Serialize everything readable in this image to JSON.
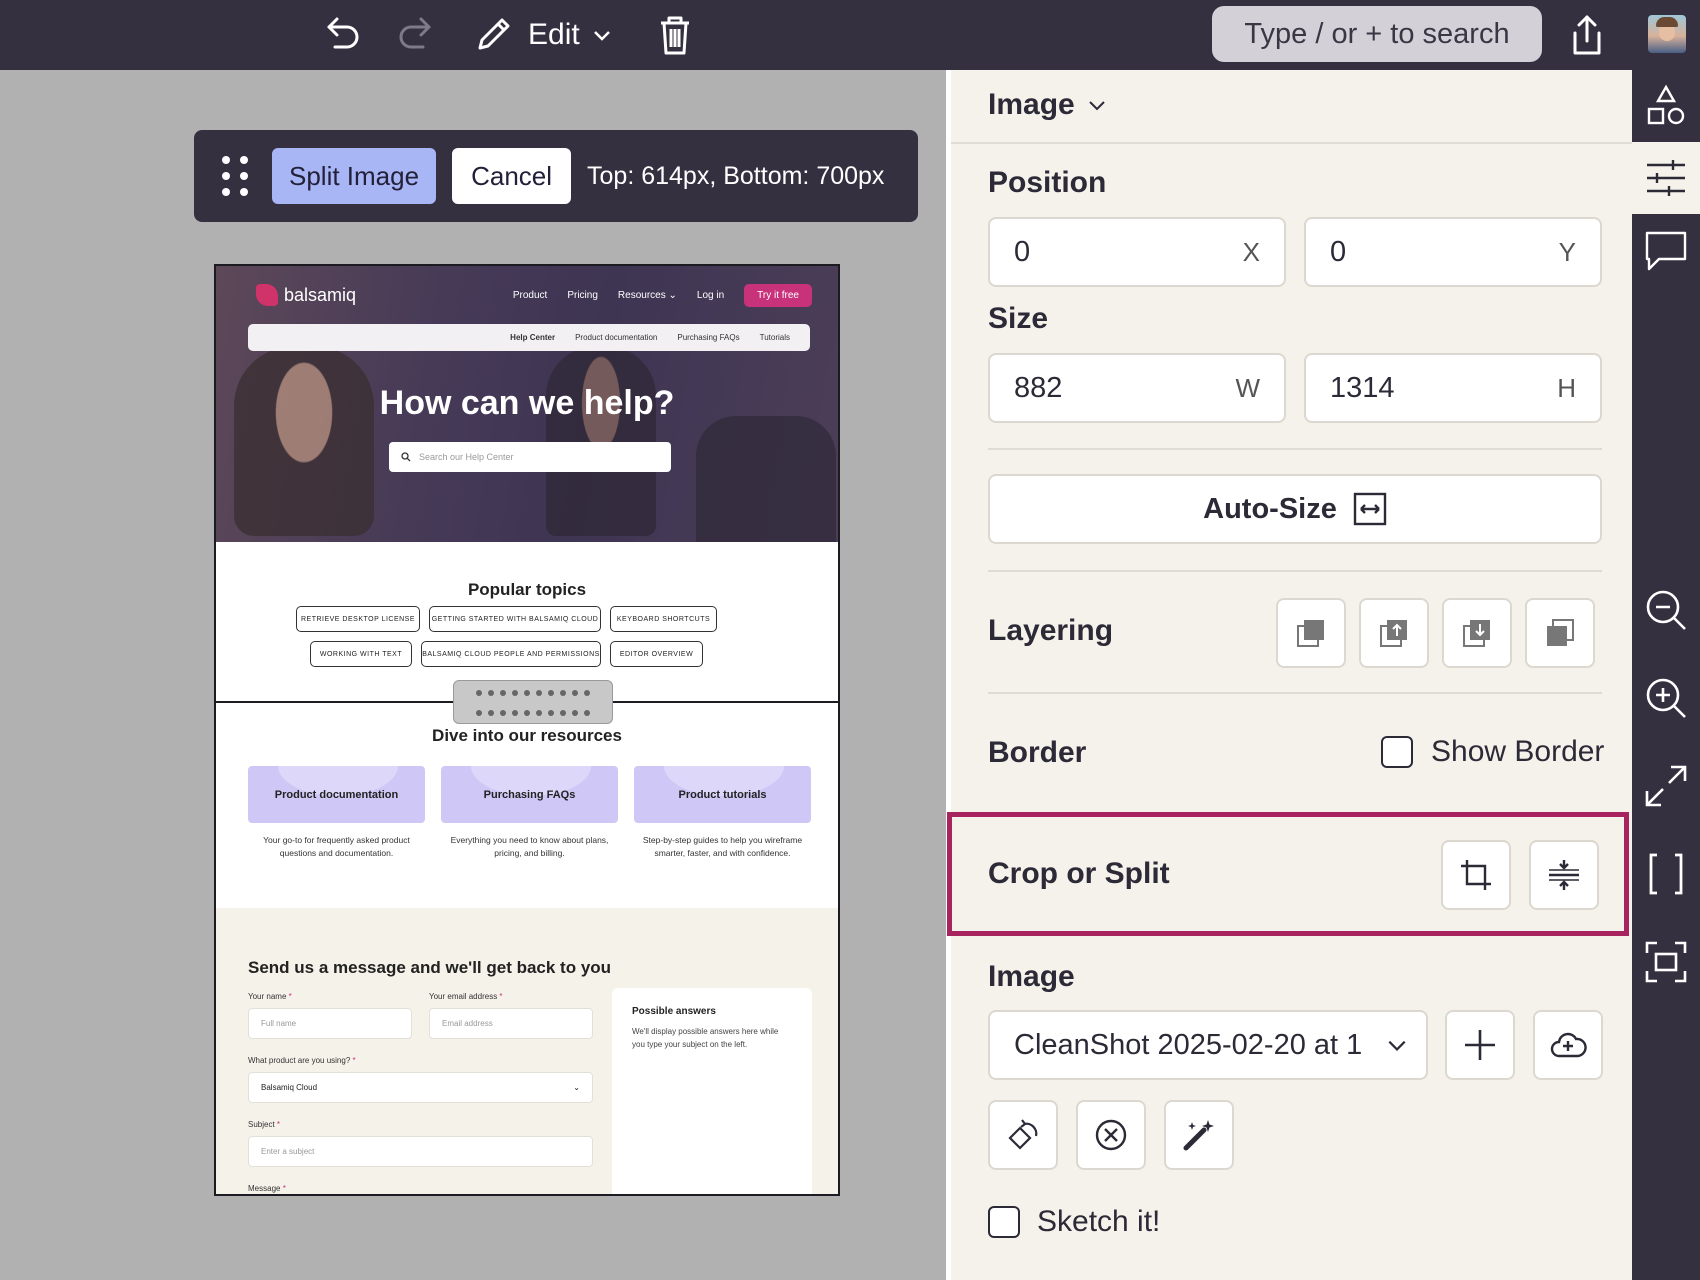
{
  "topbar": {
    "edit_label": "Edit",
    "search_placeholder": "Type / or + to search",
    "icons": [
      "undo-icon",
      "redo-icon",
      "pencil-icon",
      "chevron-down-icon",
      "trash-icon",
      "share-icon"
    ]
  },
  "split_toolbar": {
    "split_label": "Split Image",
    "cancel_label": "Cancel",
    "info": "Top: 614px, Bottom: 700px"
  },
  "screenshot": {
    "logo": "balsamiq",
    "nav": [
      "Product",
      "Pricing",
      "Resources",
      "Log in"
    ],
    "try_label": "Try it free",
    "subnav": [
      "Help Center",
      "Product documentation",
      "Purchasing FAQs",
      "Tutorials"
    ],
    "hero_title": "How can we help?",
    "search_placeholder": "Search our Help Center",
    "popular_title": "Popular topics",
    "topics": [
      "RETRIEVE DESKTOP LICENSE",
      "GETTING STARTED WITH BALSAMIQ CLOUD",
      "KEYBOARD SHORTCUTS",
      "WORKING WITH TEXT",
      "BALSAMIQ CLOUD PEOPLE AND PERMISSIONS",
      "EDITOR OVERVIEW"
    ],
    "dive_title": "Dive into our resources",
    "cards": [
      {
        "title": "Product documentation",
        "desc": "Your go-to for frequently asked product questions and documentation."
      },
      {
        "title": "Purchasing FAQs",
        "desc": "Everything you need to know about plans, pricing, and billing."
      },
      {
        "title": "Product tutorials",
        "desc": "Step-by-step guides to help you wireframe smarter, faster, and with confidence."
      }
    ],
    "form": {
      "title": "Send us a message and we'll get back to you",
      "name_label": "Your name",
      "name_placeholder": "Full name",
      "email_label": "Your email address",
      "email_placeholder": "Email address",
      "product_label": "What product are you using?",
      "product_value": "Balsamiq Cloud",
      "subject_label": "Subject",
      "subject_placeholder": "Enter a subject",
      "message_label": "Message",
      "required_mark": "*",
      "answers_title": "Possible answers",
      "answers_text": "We'll display possible answers here while you type your subject on the left."
    }
  },
  "panel": {
    "title": "Image",
    "position_label": "Position",
    "x_value": "0",
    "x_suffix": "X",
    "y_value": "0",
    "y_suffix": "Y",
    "size_label": "Size",
    "w_value": "882",
    "w_suffix": "W",
    "h_value": "1314",
    "h_suffix": "H",
    "autosize_label": "Auto-Size",
    "layering_label": "Layering",
    "border_label": "Border",
    "show_border_label": "Show Border",
    "crop_split_label": "Crop or Split",
    "image_label": "Image",
    "image_file": "CleanShot 2025-02-20 at 1",
    "sketch_label": "Sketch it!"
  },
  "rail": {
    "icons": [
      "shapes-icon",
      "sliders-icon",
      "comment-icon",
      "zoom-out-icon",
      "zoom-in-icon",
      "fit-icon",
      "brackets-icon",
      "frame-icon"
    ]
  },
  "colors": {
    "dark": "#353040",
    "panel": "#f5f2ec",
    "accent_blue": "#a9b6f5",
    "highlight": "#a8245f",
    "brand_pink": "#c8327a"
  }
}
